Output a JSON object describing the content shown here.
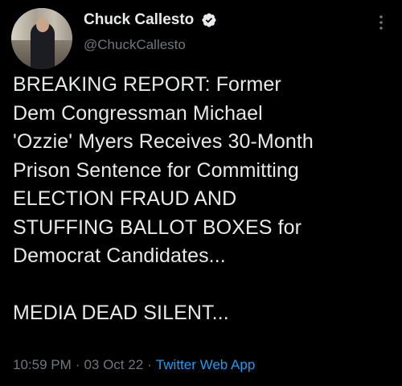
{
  "author": {
    "display_name": "Chuck Callesto",
    "handle": "@ChuckCallesto",
    "verified_icon": "verified-badge-icon",
    "avatar": "avatar-photo"
  },
  "tweet": {
    "text": "BREAKING REPORT: Former\nDem Congressman Michael\n'Ozzie' Myers Receives 30-Month\nPrison Sentence for Committing\nELECTION FRAUD AND\nSTUFFING BALLOT BOXES for\nDemocrat Candidates...\n\nMEDIA DEAD SILENT..."
  },
  "meta": {
    "time": "10:59 PM",
    "separator": "·",
    "date": "03 Oct 22",
    "source": "Twitter Web App"
  },
  "colors": {
    "background": "#000000",
    "text": "#e7e9ea",
    "secondary": "#71767b",
    "accent": "#1d9bf0"
  },
  "icons": {
    "more": "more-vertical-icon"
  }
}
